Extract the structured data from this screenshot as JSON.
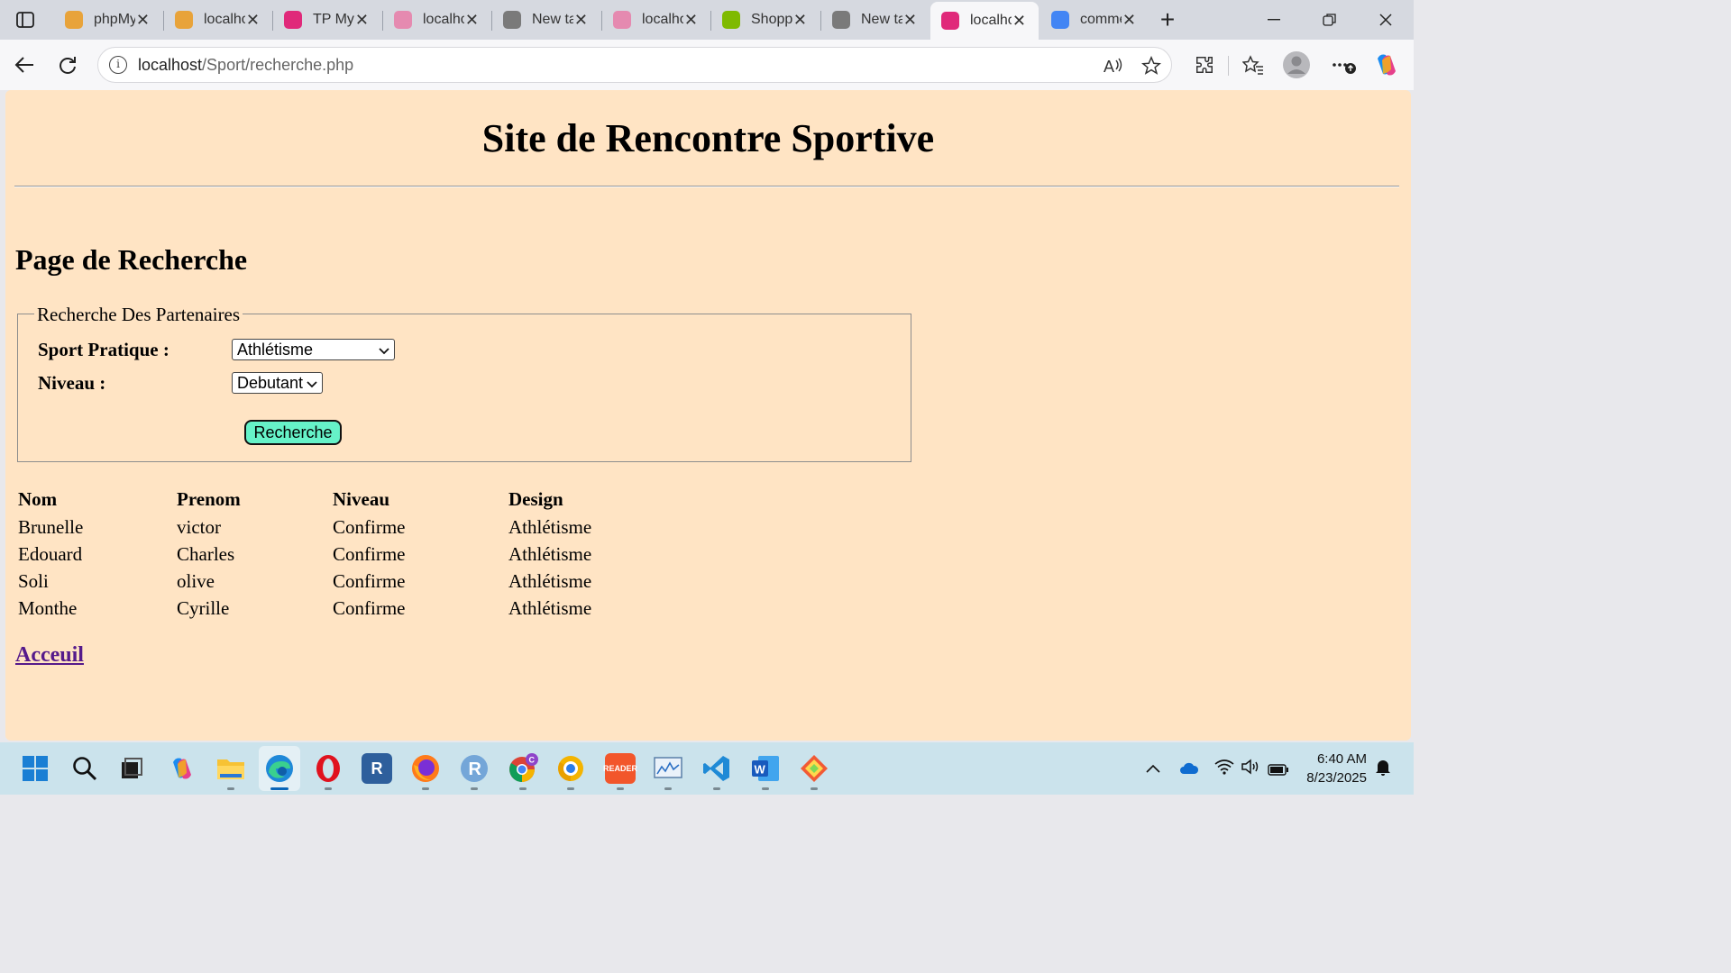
{
  "browser": {
    "tabs": [
      {
        "label": "phpMyAdmin",
        "icon": "phpmyadmin-icon",
        "color": "#e8a33a"
      },
      {
        "label": "localhost",
        "icon": "phpmyadmin-icon",
        "color": "#e8a33a"
      },
      {
        "label": "TP MySQL",
        "icon": "wamp-icon",
        "color": "#e0297a"
      },
      {
        "label": "localhost",
        "icon": "wamp-icon",
        "color": "#e58ab0"
      },
      {
        "label": "New tab",
        "icon": "newtab-icon",
        "color": "#7a7a7a"
      },
      {
        "label": "localhost",
        "icon": "wamp-icon",
        "color": "#e58ab0"
      },
      {
        "label": "Shopping",
        "icon": "microsoft-icon",
        "color": "#7fba00"
      },
      {
        "label": "New tab",
        "icon": "newtab-icon",
        "color": "#7a7a7a"
      },
      {
        "label": "localhost",
        "icon": "wamp-icon",
        "color": "#e0297a",
        "active": true
      },
      {
        "label": "comment",
        "icon": "google-icon",
        "color": "#4285f4"
      }
    ],
    "url_host": "localhost",
    "url_path": "/Sport/recherche.php"
  },
  "page": {
    "site_title": "Site de Rencontre Sportive",
    "page_title": "Page de Recherche",
    "form": {
      "legend": "Recherche Des Partenaires",
      "sport_label": "Sport Pratique :",
      "sport_value": "Athlétisme",
      "niveau_label": "Niveau :",
      "niveau_value": "Debutant",
      "submit_label": "Recherche"
    },
    "table": {
      "headers": [
        "Nom",
        "Prenom",
        "Niveau",
        "Design"
      ],
      "rows": [
        [
          "Brunelle",
          "victor",
          "Confirme",
          "Athlétisme"
        ],
        [
          "Edouard",
          "Charles",
          "Confirme",
          "Athlétisme"
        ],
        [
          "Soli",
          "olive",
          "Confirme",
          "Athlétisme"
        ],
        [
          "Monthe",
          "Cyrille",
          "Confirme",
          "Athlétisme"
        ]
      ]
    },
    "home_link": "Acceuil",
    "background_color": "#ffe4c4",
    "button_color": "#66f2c8"
  },
  "taskbar": {
    "time": "6:40 AM",
    "date": "8/23/2025",
    "apps": [
      "start-icon",
      "search-icon",
      "task-view-icon",
      "copilot-icon",
      "file-explorer-icon",
      "edge-icon",
      "opera-icon",
      "r-icon",
      "firefox-icon",
      "r-console-icon",
      "chrome-icon",
      "chrome-canary-icon",
      "reader-icon",
      "monitor-icon",
      "vscode-icon",
      "word-icon",
      "git-icon"
    ]
  }
}
